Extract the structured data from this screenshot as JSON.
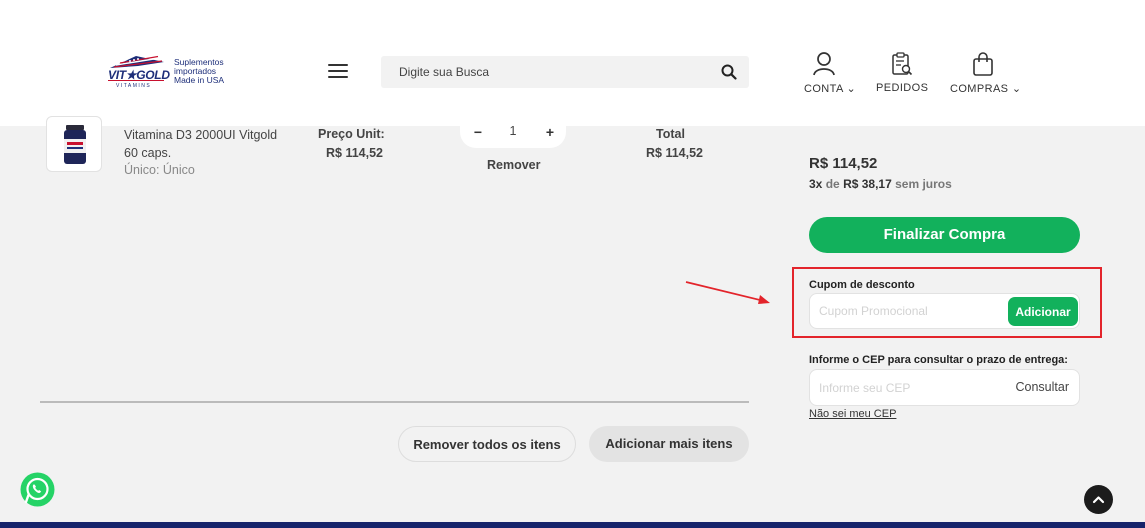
{
  "header": {
    "logo": {
      "brand": "VIT★GOLD",
      "sub": "VITAMINS",
      "tagline": [
        "Suplementos",
        "importados",
        "Made in USA"
      ]
    },
    "search": {
      "placeholder": "Digite sua Busca",
      "value": ""
    },
    "nav": {
      "account": {
        "label": "CONTA",
        "caret": "⌄",
        "icon": "user-icon"
      },
      "orders": {
        "label": "PEDIDOS",
        "icon": "orders-icon"
      },
      "cart": {
        "label": "COMPRAS",
        "caret": "⌄",
        "icon": "shopping-bag-icon"
      }
    }
  },
  "cart": {
    "item": {
      "name": "Vitamina D3 2000UI Vitgold 60 caps.",
      "variant": "Único: Único",
      "unit_price_label": "Preço Unit:",
      "unit_price": "R$ 114,52",
      "quantity": "1",
      "minus": "−",
      "plus": "+",
      "remove_label": "Remover",
      "total_label": "Total",
      "total": "R$ 114,52"
    },
    "actions": {
      "remove_all": "Remover todos os itens",
      "add_more": "Adicionar mais itens"
    }
  },
  "summary": {
    "total": "R$ 114,52",
    "installments": {
      "count": "3x",
      "of": "de",
      "value": "R$ 38,17",
      "interest": "sem juros"
    },
    "checkout_label": "Finalizar Compra",
    "coupon": {
      "label": "Cupom de desconto",
      "placeholder": "Cupom Promocional",
      "value": "",
      "button": "Adicionar"
    },
    "shipping": {
      "label": "Informe o CEP para consultar o prazo de entrega:",
      "placeholder": "Informe seu CEP",
      "value": "",
      "button": "Consultar",
      "help_link": "Não sei meu CEP"
    }
  },
  "floating": {
    "whatsapp_icon": "whatsapp-icon",
    "back_to_top_icon": "chevron-up-icon"
  },
  "colors": {
    "accent_green": "#12b15c",
    "annotation_red": "#e3242b",
    "footer_navy": "#16236b",
    "brand_navy": "#1e2f7a",
    "brand_red": "#c8102e"
  }
}
